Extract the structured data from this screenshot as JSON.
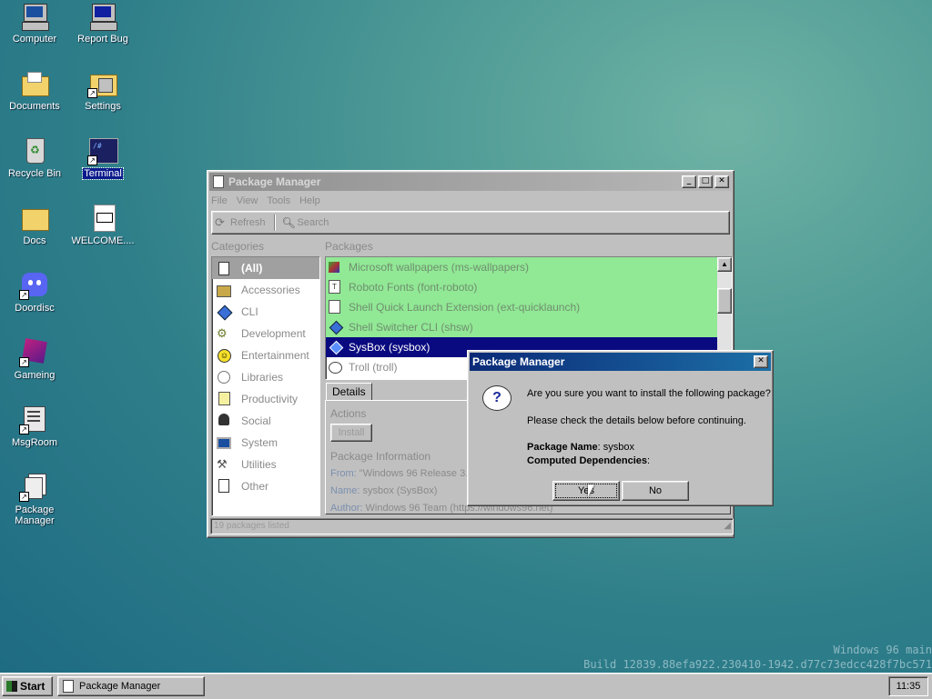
{
  "desktop": {
    "icons": [
      {
        "label": "Computer",
        "icon": "computer-icon"
      },
      {
        "label": "Report Bug",
        "icon": "report-bug-icon"
      },
      {
        "label": "Documents",
        "icon": "documents-folder-icon"
      },
      {
        "label": "Settings",
        "icon": "settings-icon"
      },
      {
        "label": "Recycle Bin",
        "icon": "recycle-bin-icon"
      },
      {
        "label": "Terminal",
        "icon": "terminal-icon"
      },
      {
        "label": "Docs",
        "icon": "folder-icon"
      },
      {
        "label": "WELCOME....",
        "icon": "markdown-file-icon"
      },
      {
        "label": "Doordisc",
        "icon": "doordisc-icon"
      },
      {
        "label": "Gameing",
        "icon": "gameing-icon"
      },
      {
        "label": "MsgRoom",
        "icon": "msgroom-icon"
      },
      {
        "label": "Package Manager",
        "icon": "package-manager-icon"
      }
    ],
    "watermark_line1": "Windows 96 main",
    "watermark_line2": "Build 12839.88efa922.230410-1942.d77c73edcc428f7bc571"
  },
  "window": {
    "title": "Package Manager",
    "menu": [
      "File",
      "View",
      "Tools",
      "Help"
    ],
    "toolbar": {
      "refresh": "Refresh",
      "search": "Search"
    },
    "categories_heading": "Categories",
    "packages_heading": "Packages",
    "categories": [
      {
        "label": "(All)",
        "icon": "all-icon",
        "selected": true
      },
      {
        "label": "Accessories",
        "icon": "accessories-icon"
      },
      {
        "label": "CLI",
        "icon": "cli-diamond-icon"
      },
      {
        "label": "Development",
        "icon": "development-icon"
      },
      {
        "label": "Entertainment",
        "icon": "smiley-icon"
      },
      {
        "label": "Libraries",
        "icon": "libraries-icon"
      },
      {
        "label": "Productivity",
        "icon": "productivity-icon"
      },
      {
        "label": "Social",
        "icon": "social-icon"
      },
      {
        "label": "System",
        "icon": "system-icon"
      },
      {
        "label": "Utilities",
        "icon": "utilities-icon"
      },
      {
        "label": "Other",
        "icon": "other-icon"
      }
    ],
    "packages": [
      {
        "label": "Microsoft wallpapers (ms-wallpapers)",
        "installed": true
      },
      {
        "label": "Roboto Fonts (font-roboto)",
        "installed": true
      },
      {
        "label": "Shell Quick Launch Extension (ext-quicklaunch)",
        "installed": true
      },
      {
        "label": "Shell Switcher CLI (shsw)",
        "installed": true
      },
      {
        "label": "SysBox (sysbox)",
        "selected": true
      },
      {
        "label": "Troll (troll)"
      }
    ],
    "details": {
      "tab": "Details",
      "actions_heading": "Actions",
      "install_label": "Install",
      "info_heading": "Package Information",
      "from_label": "From:",
      "from_value": "\"Windows 96 Release 3.(",
      "name_label": "Name:",
      "name_value": "sysbox (SysBox)",
      "author_label": "Author:",
      "author_value": "Windows 96 Team (https://windows96.net)"
    },
    "status": "19 packages listed"
  },
  "dialog": {
    "title": "Package Manager",
    "line1": "Are you sure you want to install the following package?",
    "line2": "Please check the details below before continuing.",
    "pkg_name_label": "Package Name",
    "pkg_name_value": ": sysbox",
    "deps_label": "Computed Dependencies",
    "deps_value": ":",
    "yes": "Yes",
    "no": "No"
  },
  "taskbar": {
    "start": "Start",
    "task": "Package Manager",
    "clock": "11:35"
  }
}
